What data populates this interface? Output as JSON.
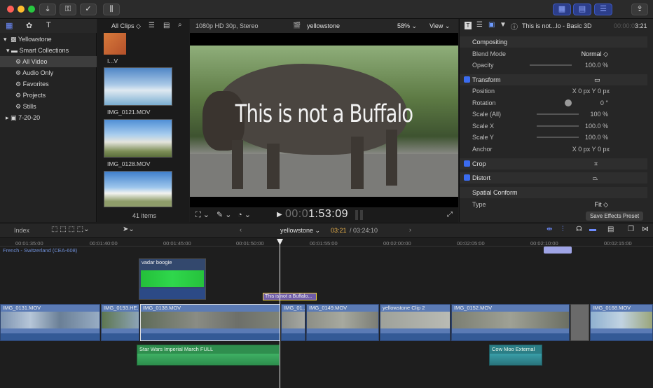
{
  "toolbar": {
    "icons": [
      "close-light",
      "minimize-light",
      "zoom-light",
      "import-icon",
      "keyword-icon",
      "checkmark-icon",
      "background-tasks-icon",
      "layout-browser-icon",
      "layout-timeline-icon",
      "layout-inspector-icon",
      "share-icon"
    ]
  },
  "library": {
    "items": [
      {
        "label": "Yellowstone"
      },
      {
        "label": "Smart Collections"
      },
      {
        "label": "All Video"
      },
      {
        "label": "Audio Only"
      },
      {
        "label": "Favorites"
      },
      {
        "label": "Projects"
      },
      {
        "label": "Stills"
      },
      {
        "label": "7-20-20"
      }
    ]
  },
  "browser": {
    "filter": "All Clips ◇",
    "clips": [
      {
        "name": "I...V"
      },
      {
        "name": "IMG_0121.MOV"
      },
      {
        "name": "IMG_0128.MOV"
      },
      {
        "name": ""
      }
    ],
    "count": "41 items"
  },
  "viewer": {
    "format": "1080p HD 30p, Stereo",
    "project": "yellowstone",
    "zoom": "58%",
    "view_label": "View",
    "title_overlay": "This is not a Buffalo",
    "timecode_dim": "00:0",
    "timecode": "1:53:09"
  },
  "inspector": {
    "title": "This is not...lo - Basic 3D",
    "duration_dim": "00:00:0",
    "duration": "3:21",
    "sections": [
      {
        "label": "Compositing",
        "value": ""
      },
      {
        "label": "Blend Mode",
        "value": "Normal ◇"
      },
      {
        "label": "Opacity",
        "value": "100.0 %"
      },
      {
        "label": "Transform",
        "value": ""
      },
      {
        "label": "Position",
        "value": "X   0 px   Y   0 px"
      },
      {
        "label": "Rotation",
        "value": "0 °"
      },
      {
        "label": "Scale (All)",
        "value": "100 %"
      },
      {
        "label": "Scale X",
        "value": "100.0 %"
      },
      {
        "label": "Scale Y",
        "value": "100.0 %"
      },
      {
        "label": "Anchor",
        "value": "X   0 px   Y   0 px"
      },
      {
        "label": "Crop",
        "value": ""
      },
      {
        "label": "Distort",
        "value": ""
      },
      {
        "label": "Spatial Conform",
        "value": ""
      },
      {
        "label": "Type",
        "value": "Fit ◇"
      }
    ],
    "save_preset": "Save Effects Preset"
  },
  "timeline": {
    "index_label": "Index",
    "project": "yellowstone ⌄",
    "position": "03:21",
    "duration": "/ 03:24:10",
    "ruler": [
      "00:01:35:00",
      "00:01:40:00",
      "00:01:45:00",
      "00:01:50:00",
      "00:01:55:00",
      "00:02:00:00",
      "00:02:05:00",
      "00:02:10:00",
      "00:02:15:00"
    ],
    "caption_track": "French - Switzerland (CEA-608)",
    "title_clip": "This is not a Buffalo...",
    "connected_clip": "vadar boogie",
    "clips": [
      "IMG_0131.MOV",
      "IMG_0193.HE...",
      "IMG_0138.MOV",
      "IMG_01...",
      "IMG_0149.MOV",
      "yellowstone Clip 2",
      "IMG_0152.MOV",
      "IMG_0168.MOV"
    ],
    "audio": [
      "Star Wars Imperial March FULL",
      "Cow Moo External"
    ]
  }
}
